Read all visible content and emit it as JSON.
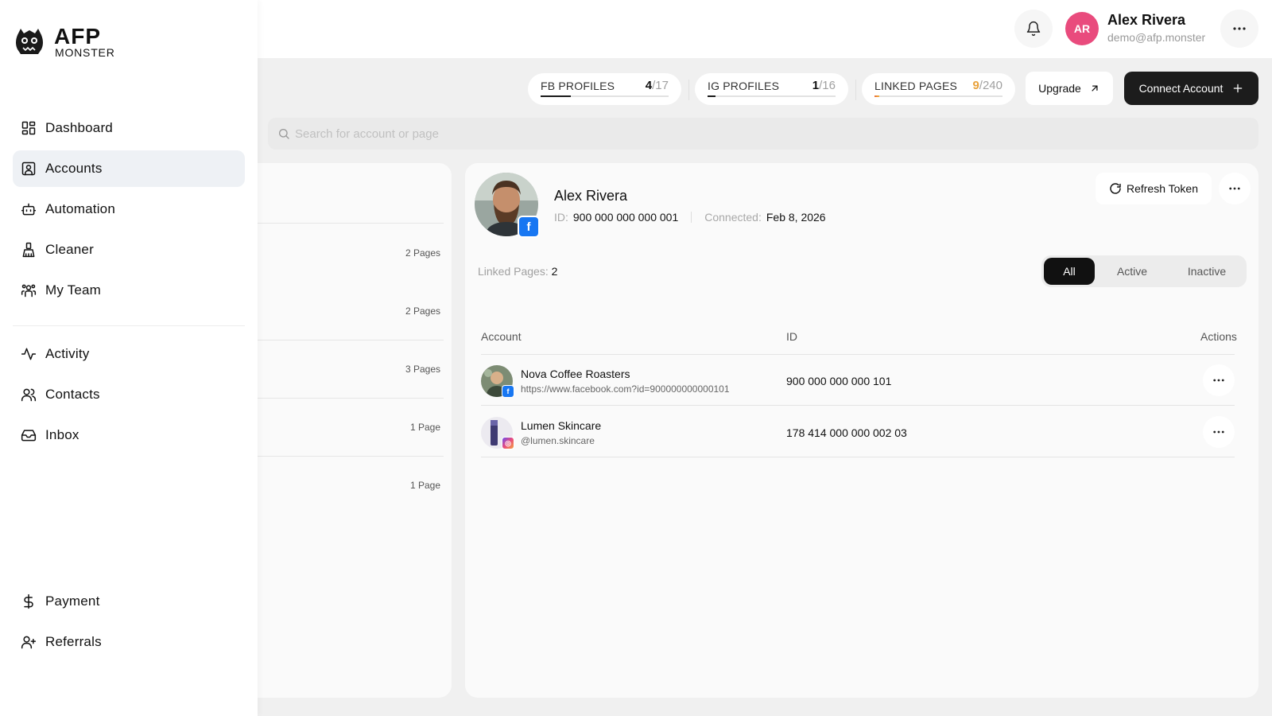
{
  "brand": {
    "name": "AFP",
    "tagline": "MONSTER"
  },
  "nav": {
    "main": [
      {
        "label": "Dashboard",
        "icon": "dashboard-icon",
        "active": false
      },
      {
        "label": "Accounts",
        "icon": "accounts-icon",
        "active": true
      },
      {
        "label": "Automation",
        "icon": "robot-icon",
        "active": false
      },
      {
        "label": "Cleaner",
        "icon": "broom-icon",
        "active": false
      },
      {
        "label": "My Team",
        "icon": "team-icon",
        "active": false
      }
    ],
    "secondary": [
      {
        "label": "Activity",
        "icon": "activity-icon"
      },
      {
        "label": "Contacts",
        "icon": "contacts-icon"
      },
      {
        "label": "Inbox",
        "icon": "inbox-icon"
      }
    ],
    "bottom": [
      {
        "label": "Payment",
        "icon": "dollar-icon"
      },
      {
        "label": "Referrals",
        "icon": "user-plus-icon"
      }
    ]
  },
  "header": {
    "user": {
      "initials": "AR",
      "name": "Alex Rivera",
      "email": "demo@afp.monster",
      "avatar_color": "#e94b7d"
    }
  },
  "stats": [
    {
      "label": "FB PROFILES",
      "current": "4",
      "total": "/17",
      "progress": 0.235
    },
    {
      "label": "IG PROFILES",
      "current": "1",
      "total": "/16",
      "progress": 0.0625
    },
    {
      "label": "LINKED PAGES",
      "current": "9",
      "total": "/240",
      "progress": 0.0375
    }
  ],
  "actions": {
    "upgrade": "Upgrade",
    "connect": "Connect Account"
  },
  "search": {
    "placeholder": "Search for account or page",
    "value": ""
  },
  "account_list": {
    "counts": [
      "2 Pages",
      "2 Pages",
      "3 Pages",
      "1 Page",
      "1 Page"
    ]
  },
  "profile": {
    "name": "Alex Rivera",
    "id_label": "ID:",
    "id": "900 000 000 000 001",
    "connected_label": "Connected:",
    "connected": "Feb 8, 2026",
    "refresh_label": "Refresh Token",
    "linked_label": "Linked Pages:",
    "linked_count": "2",
    "filters": [
      "All",
      "Active",
      "Inactive"
    ],
    "active_filter": "All"
  },
  "table": {
    "columns": [
      "Account",
      "ID",
      "Actions"
    ],
    "rows": [
      {
        "name": "Nova Coffee Roasters",
        "sub": "https://www.facebook.com?id=900000000000101",
        "id": "900 000 000 000 101",
        "platform": "facebook"
      },
      {
        "name": "Lumen Skincare",
        "sub": "@lumen.skincare",
        "id": "178 414 000 000 002 03",
        "platform": "instagram"
      }
    ]
  },
  "colors": {
    "accent": "#1c1c1c",
    "facebook": "#1877f2",
    "linked_progress": "#e8a13a",
    "active_nav_bg": "#eef1f5"
  }
}
